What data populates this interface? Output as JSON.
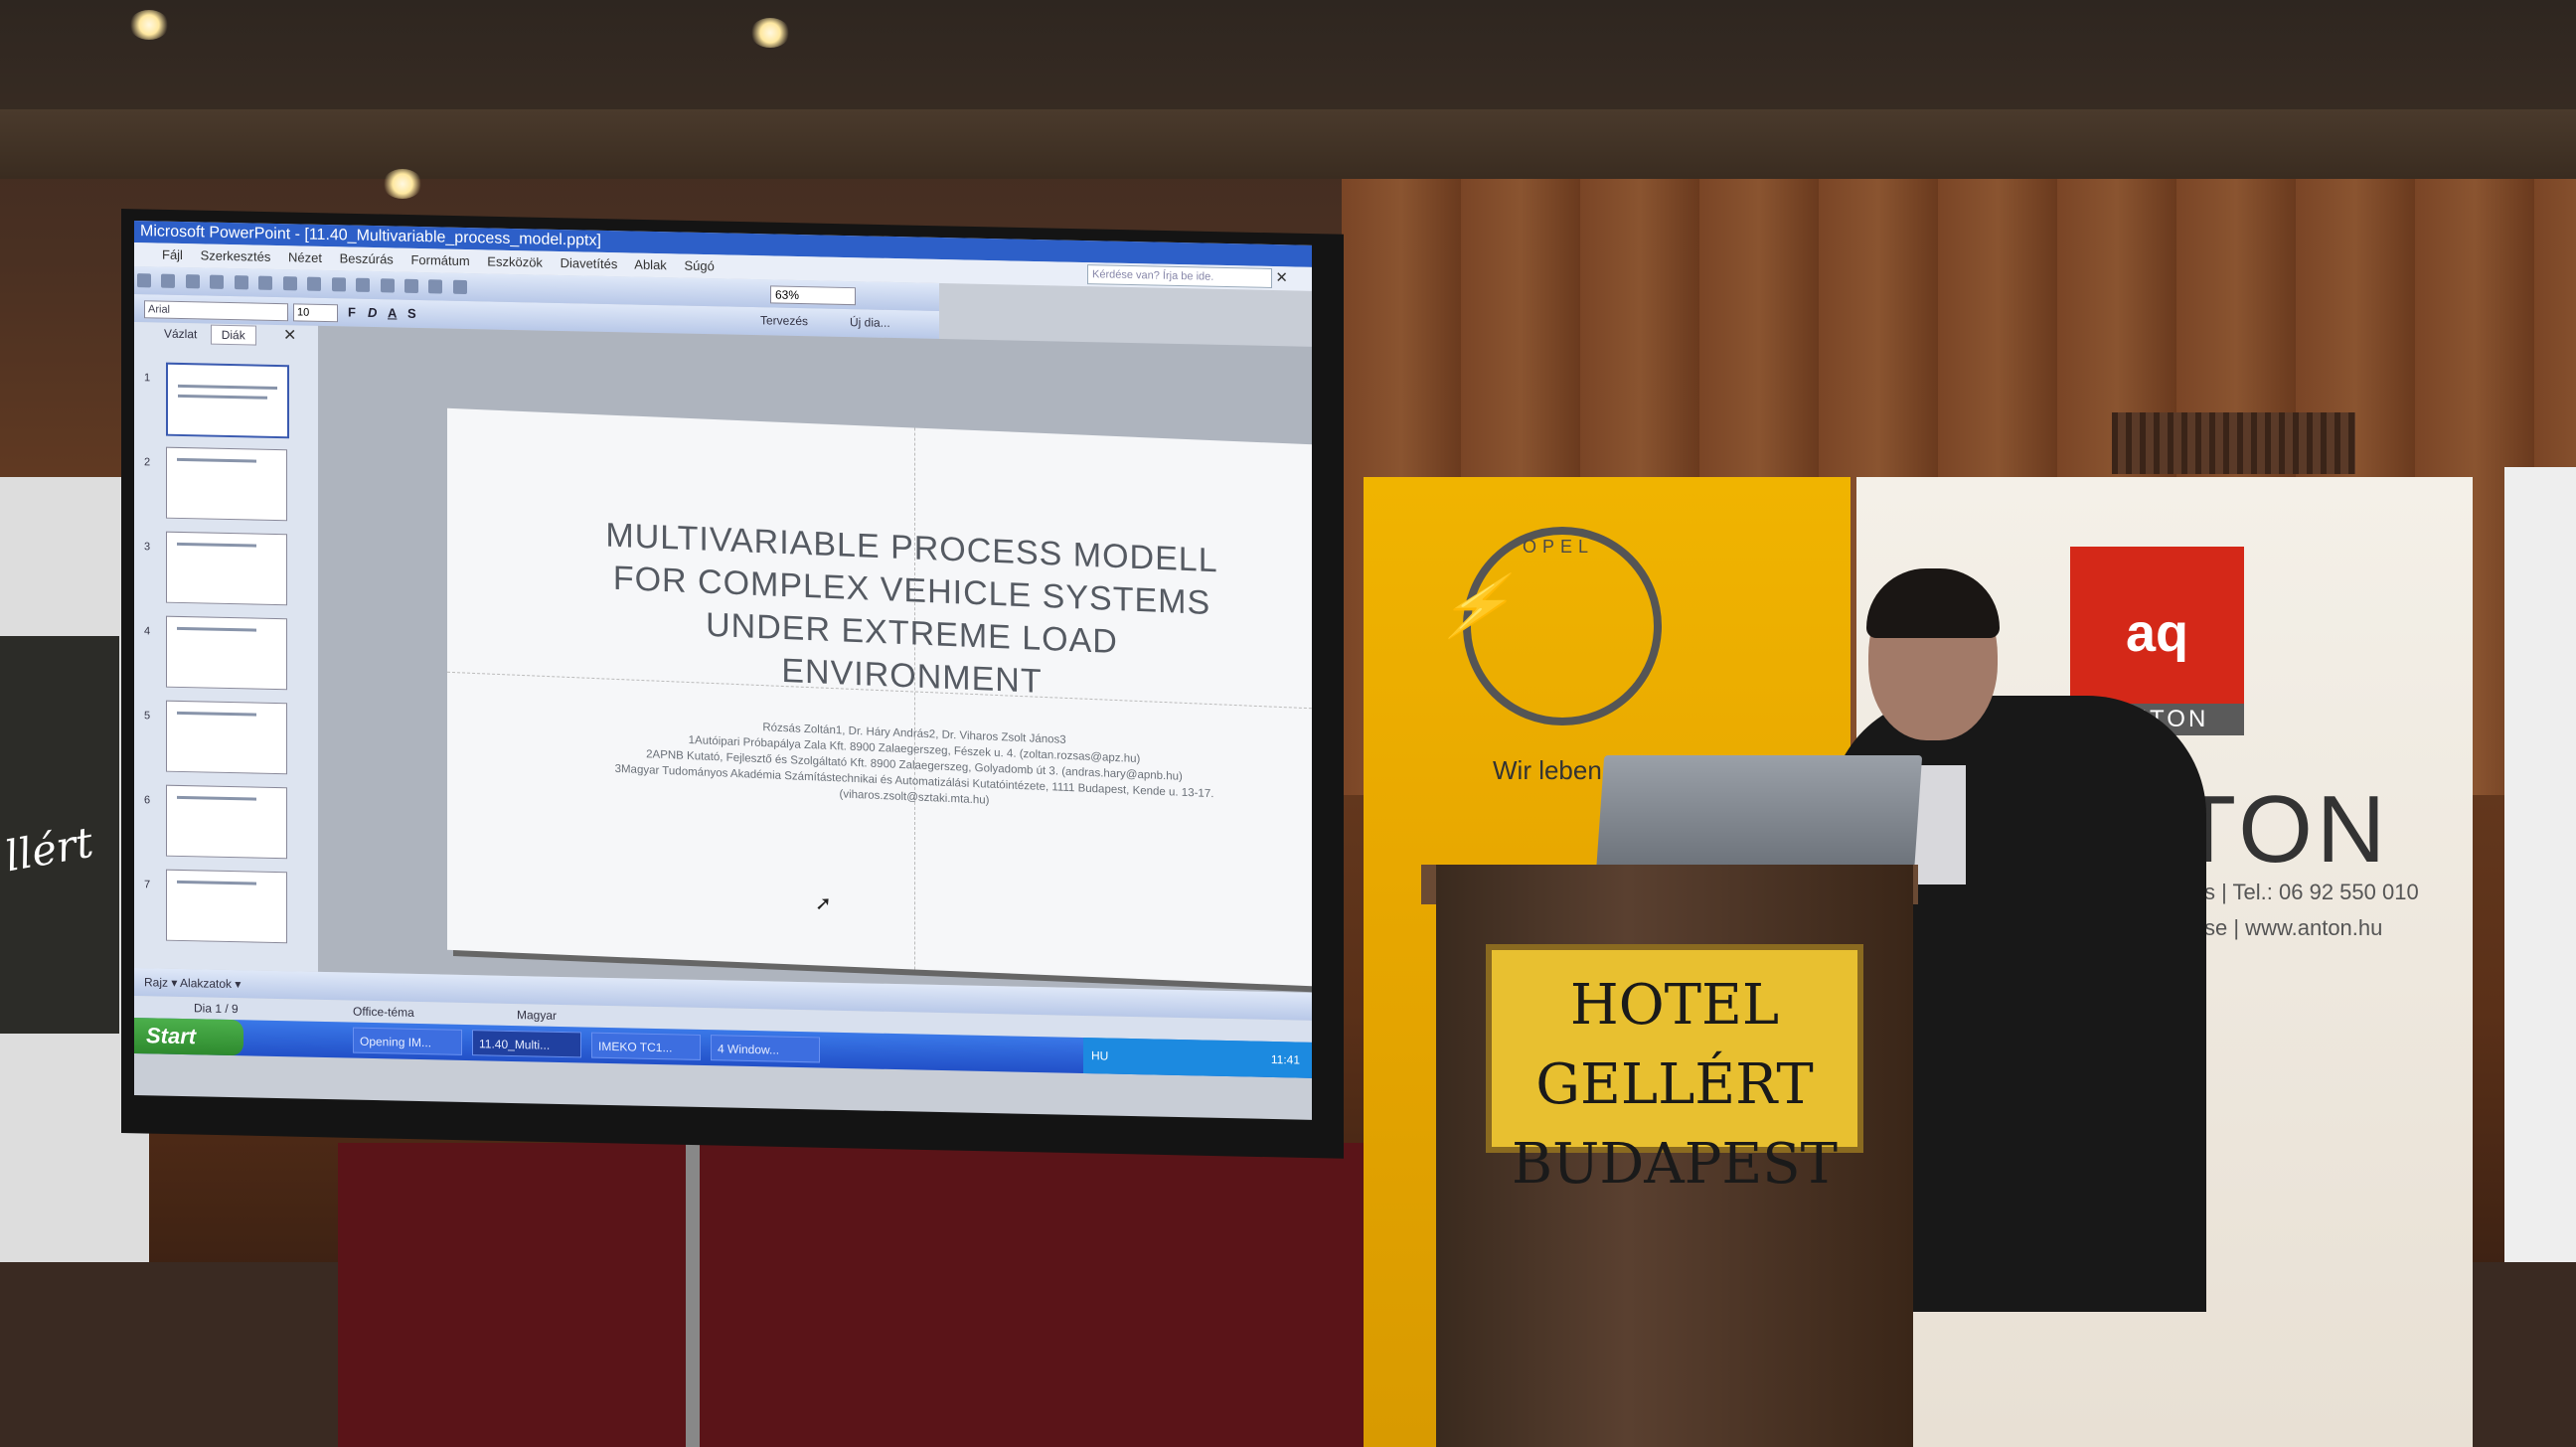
{
  "powerpoint": {
    "title_bar": "Microsoft PowerPoint - [11.40_Multivariable_process_model.pptx]",
    "search_placeholder": "Kérdése van? Írja be ide.",
    "menu": [
      "Fájl",
      "Szerkesztés",
      "Nézet",
      "Beszúrás",
      "Formátum",
      "Eszközök",
      "Diavetítés",
      "Ablak",
      "Súgó"
    ],
    "zoom": "63%",
    "font_name": "Arial",
    "font_size": "10",
    "format_buttons": [
      "F",
      "D",
      "A",
      "S"
    ],
    "tervezes_label": "Tervezés",
    "uj_dia_label": "Új dia...",
    "pane_tabs": [
      "Vázlat",
      "Diák"
    ],
    "thumbnails": [
      "1",
      "2",
      "3",
      "4",
      "5",
      "6",
      "7"
    ],
    "slide": {
      "title_lines": [
        "MULTIVARIABLE PROCESS MODELL",
        "FOR COMPLEX VEHICLE SYSTEMS",
        "UNDER EXTREME LOAD",
        "ENVIRONMENT"
      ],
      "author_lines": [
        "Rózsás Zoltán1, Dr. Háry András2, Dr. Viharos Zsolt János3",
        "1Autóipari Próbapálya Zala Kft. 8900 Zalaegerszeg, Fészek u. 4. (zoltan.rozsas@apz.hu)",
        "2APNB Kutató, Fejlesztő és Szolgáltató Kft. 8900 Zalaegerszeg, Golyadomb út 3. (andras.hary@apnb.hu)",
        "3Magyar Tudományos Akadémia Számítástechnikai és Automatizálási Kutatóintézete, 1111 Budapest, Kende u. 13-17. (viharos.zsolt@sztaki.mta.hu)"
      ]
    },
    "drawbar": "Rajz ▾   Alakzatok ▾",
    "status": {
      "slide": "Dia 1 / 9",
      "theme": "Office-téma",
      "language": "Magyar"
    },
    "taskbar": {
      "start": "Start",
      "tasks": [
        "Opening IM...",
        "11.40_Multi...",
        "IMEKO TC1...",
        "4 Window..."
      ],
      "lang": "HU",
      "clock": "11:41"
    }
  },
  "scene": {
    "opel_word": "OPEL",
    "opel_slogan": "Wir leben",
    "aq_logo": "aq",
    "anton_small": "ANTON",
    "anton_big": "NTON",
    "anton_contact": [
      "s | Tel.: 06 92 550 010",
      "se | www.anton.hu"
    ],
    "podium_plaque": [
      "HOTEL GELLÉRT",
      "BUDAPEST"
    ],
    "left_poster": "llért"
  },
  "colors": {
    "taskbar": "#2250c8",
    "start_button": "#2e8a2e",
    "opel_yellow": "#f0b400",
    "anton_red": "#d42818",
    "plaque_yellow": "#e8c030"
  }
}
